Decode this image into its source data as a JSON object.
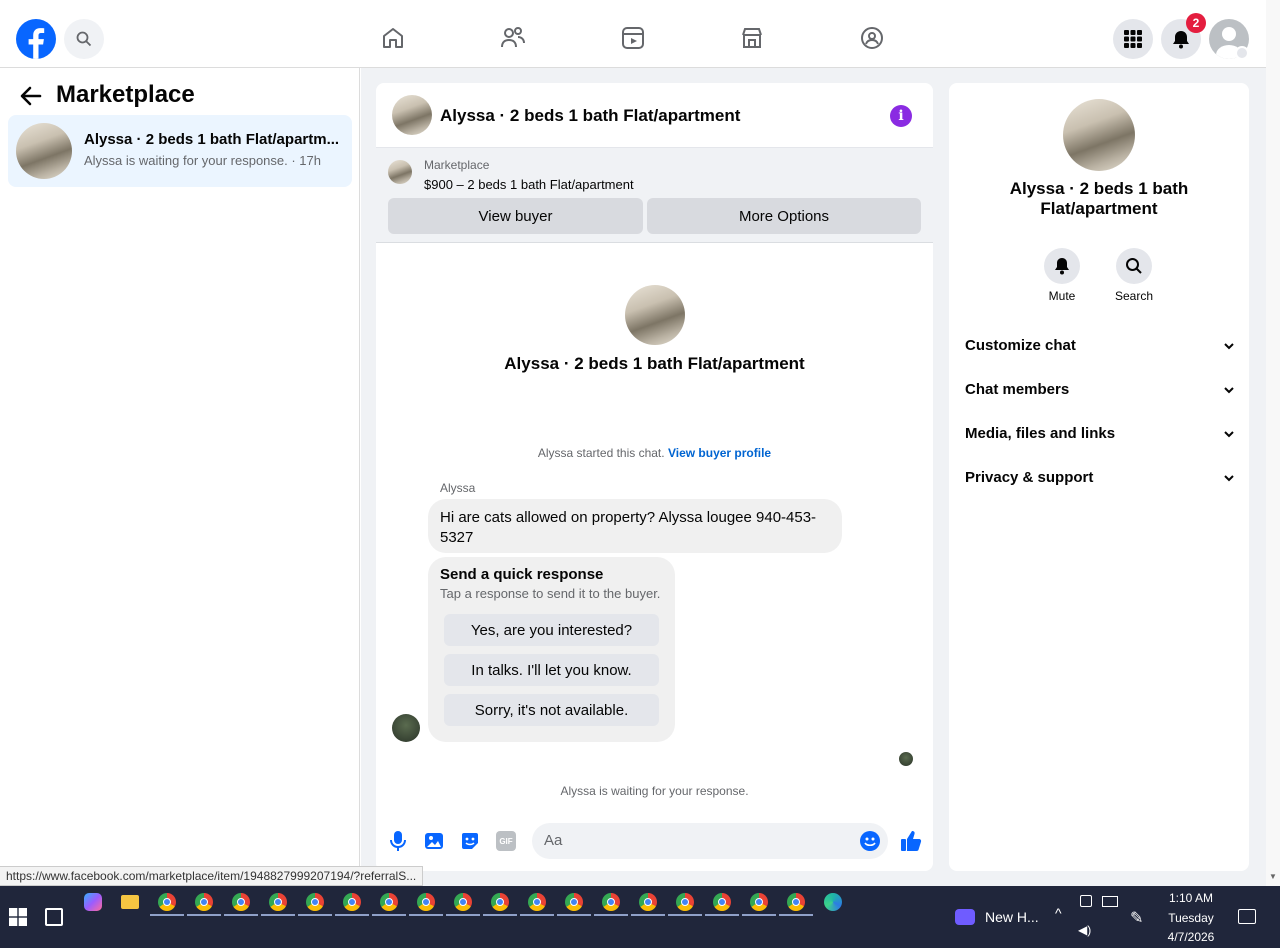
{
  "header": {
    "notifications_badge": "2"
  },
  "left": {
    "title": "Marketplace",
    "conversation": {
      "title": "Alyssa · 2 beds 1 bath Flat/apartm...",
      "subtitle": "Alyssa is waiting for your response. · 17h"
    }
  },
  "chat": {
    "header_title": "Alyssa · 2 beds 1 bath Flat/apartment",
    "listing_source": "Marketplace",
    "listing_text": "$900 – 2 beds 1 bath Flat/apartment",
    "view_buyer": "View buyer",
    "more_options": "More Options",
    "intro_title": "Alyssa · 2 beds 1 bath Flat/apartment",
    "started_text": "Alyssa started this chat.",
    "view_profile": "View buyer profile",
    "sender": "Alyssa",
    "message": "Hi are cats allowed on property? Alyssa lougee 940-453-5327",
    "quick_title": "Send a quick response",
    "quick_sub": "Tap a response to send it to the buyer.",
    "quick_options": [
      "Yes, are you interested?",
      "In talks. I'll let you know.",
      "Sorry, it's not available."
    ],
    "waiting": "Alyssa is waiting for your response.",
    "composer_placeholder": "Aa"
  },
  "info": {
    "title": "Alyssa · 2 beds 1 bath Flat/apartment",
    "mute": "Mute",
    "search": "Search",
    "sections": [
      "Customize chat",
      "Chat members",
      "Media, files and links",
      "Privacy & support"
    ]
  },
  "status_url": "https://www.facebook.com/marketplace/item/1948827999207194/?referralS...",
  "taskbar": {
    "app_label": "New H...",
    "time": "1:10 AM",
    "day": "Tuesday",
    "date": "4/7/2026"
  },
  "colors": {
    "brand": "#0866ff",
    "accent": "#8a2be2"
  }
}
